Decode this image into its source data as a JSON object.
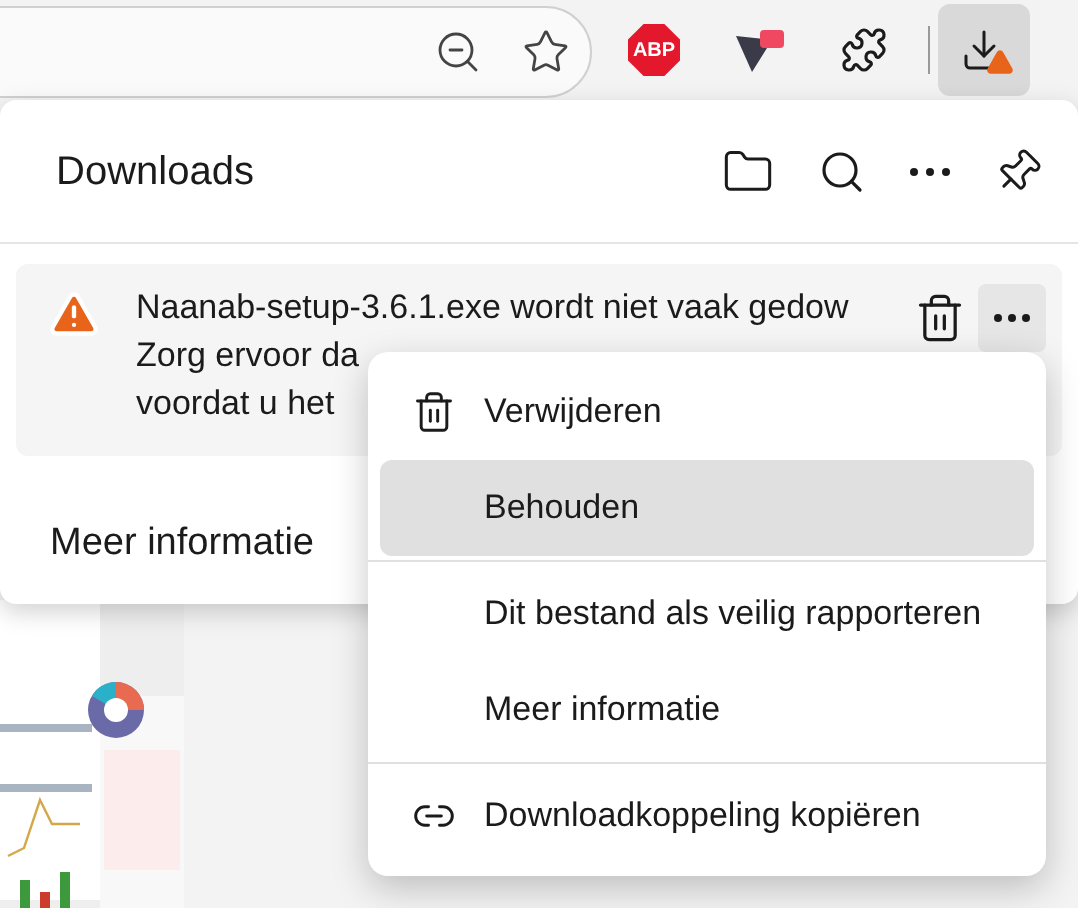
{
  "toolbar": {
    "adblock_label": "ABP",
    "downloads_button": {
      "selected": true
    }
  },
  "panel": {
    "title": "Downloads",
    "item": {
      "message_lines": [
        "Naanab-setup-3.6.1.exe wordt niet vaak gedow",
        "Zorg ervoor da",
        "voordat u het"
      ],
      "more_selected": true
    },
    "more_info": "Meer informatie"
  },
  "menu": {
    "groups": [
      [
        {
          "kind": "delete",
          "label": "Verwijderen",
          "selected": false
        },
        {
          "kind": "plain",
          "label": "Behouden",
          "selected": true
        }
      ],
      [
        {
          "kind": "plain",
          "label": "Dit bestand als veilig rapporteren",
          "selected": false
        },
        {
          "kind": "plain",
          "label": "Meer informatie",
          "selected": false
        }
      ],
      [
        {
          "kind": "link",
          "label": "Downloadkoppeling kopiëren",
          "selected": false
        }
      ]
    ]
  }
}
